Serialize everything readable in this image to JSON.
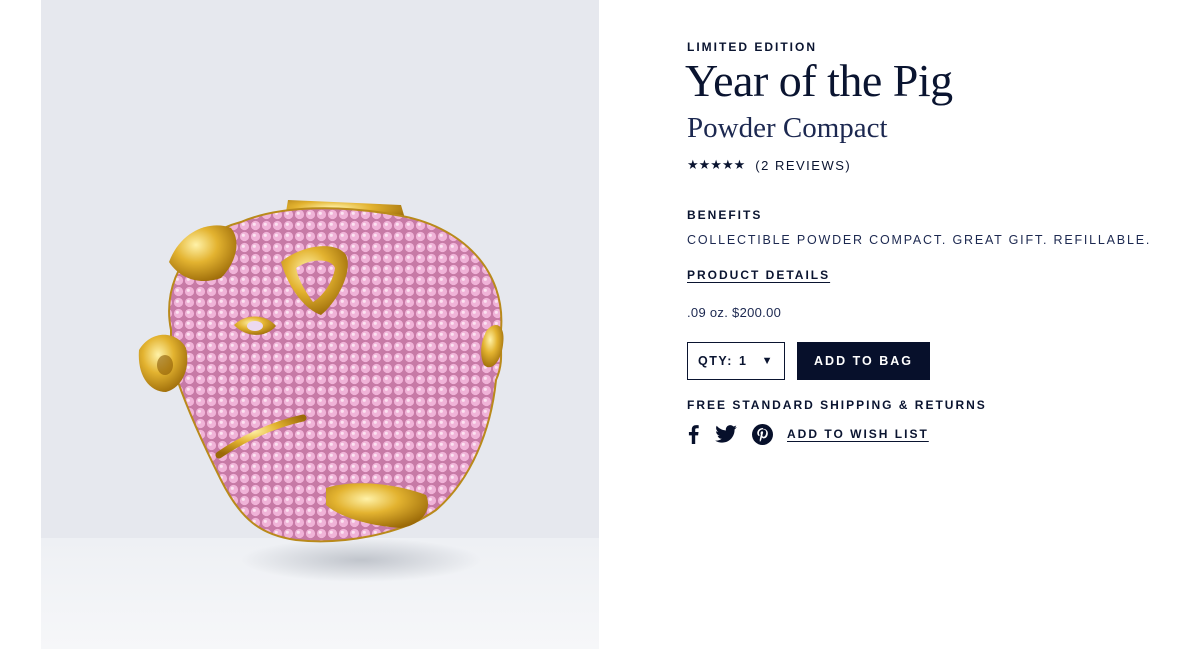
{
  "product": {
    "eyebrow": "LIMITED EDITION",
    "title": "Year of the Pig",
    "subtitle": "Powder Compact",
    "image_icon": "pig-compact-image",
    "rating": {
      "stars": "★★★★★",
      "value": 5,
      "max": 5,
      "reviews_label": "(2 REVIEWS)"
    },
    "benefits": {
      "label": "BENEFITS",
      "text": "COLLECTIBLE POWDER COMPACT. GREAT GIFT. REFILLABLE."
    },
    "details_link": "PRODUCT DETAILS",
    "size_price": ".09 oz. $200.00"
  },
  "purchase": {
    "qty_label": "QTY:",
    "qty_value": "1",
    "add_to_bag": "ADD TO BAG"
  },
  "shipping": {
    "text": "FREE STANDARD SHIPPING & RETURNS"
  },
  "social": {
    "icons": [
      "facebook-icon",
      "twitter-icon",
      "pinterest-icon"
    ],
    "wish_list": "ADD TO WISH LIST"
  },
  "colors": {
    "navy": "#07102b",
    "image_background": "#e6e8ee",
    "pink_crystal": "#e59ac7",
    "gold": "#d8a520"
  }
}
